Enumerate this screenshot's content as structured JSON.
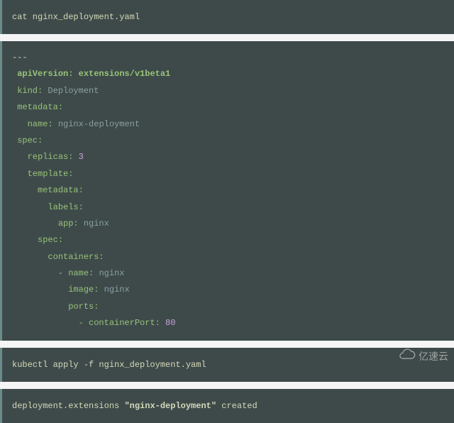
{
  "block1": {
    "cmd": "cat nginx_deployment.yaml"
  },
  "block2": {
    "dashes": "---",
    "apiVersion_k": "apiVersion:",
    "apiVersion_v": "extensions/v1beta1",
    "kind_k": "kind:",
    "kind_v": "Deployment",
    "metadata_k": "metadata:",
    "name_k": "name:",
    "name_v": "nginx-deployment",
    "spec_k": "spec:",
    "replicas_k": "replicas:",
    "replicas_v": "3",
    "template_k": "template:",
    "t_metadata_k": "metadata:",
    "labels_k": "labels:",
    "app_k": "app:",
    "app_v": "nginx",
    "t_spec_k": "spec:",
    "containers_k": "containers:",
    "c_name_k": "- name:",
    "c_name_v": "nginx",
    "image_k": "image:",
    "image_v": "nginx",
    "ports_k": "ports:",
    "cport_k": "- containerPort:",
    "cport_v": "80"
  },
  "block3": {
    "cmd": "kubectl apply -f nginx_deployment.yaml"
  },
  "block4": {
    "pre": "deployment.extensions ",
    "name": "\"nginx-deployment\"",
    "post": " created"
  },
  "watermark": {
    "text": "亿速云"
  }
}
